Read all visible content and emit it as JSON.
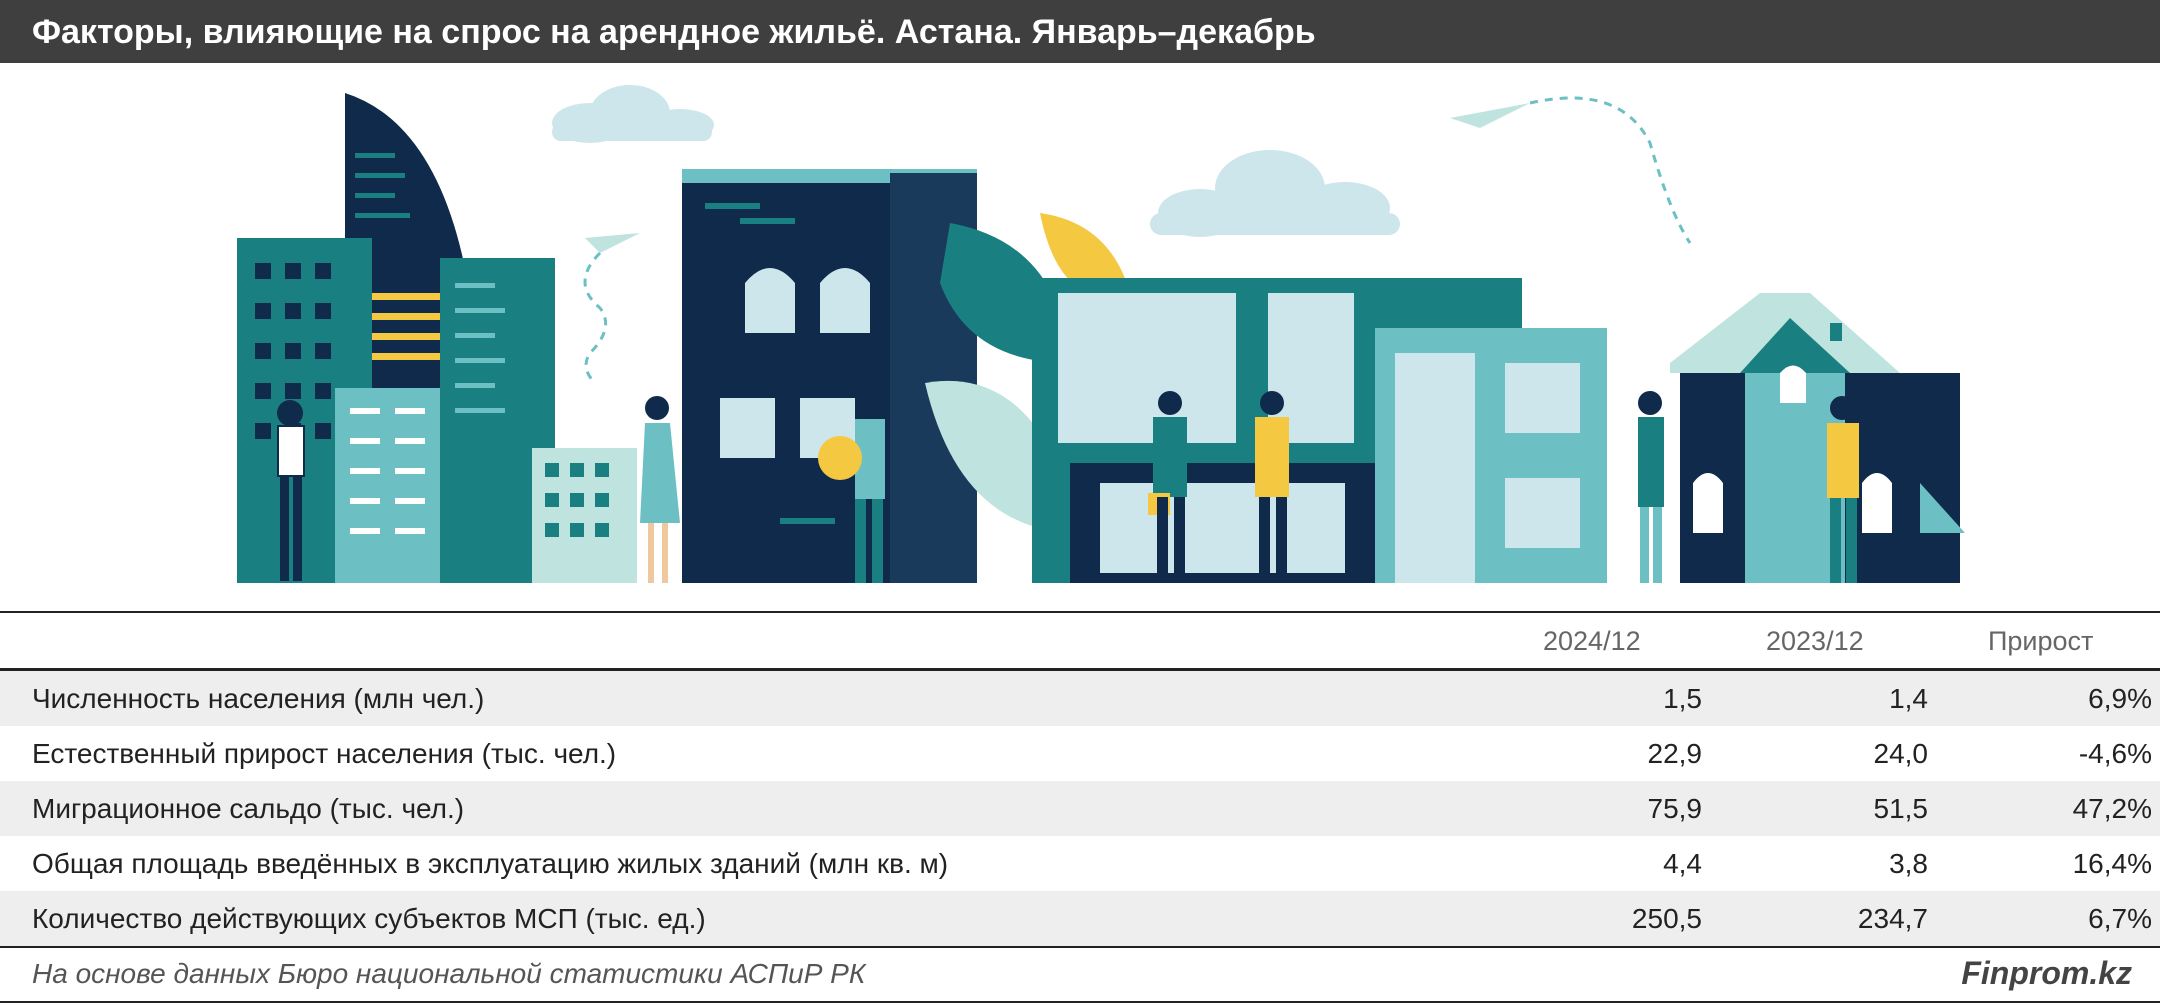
{
  "header": {
    "title": "Факторы, влияющие на спрос на арендное жильё. Астана. Январь–декабрь"
  },
  "colors": {
    "title_bar": "#3f3f3f",
    "dark_navy": "#0f2a4a",
    "teal": "#1a7f80",
    "light_teal": "#6cc0c4",
    "pale_mint": "#bfe3df",
    "yellow": "#f5c842",
    "cloud": "#cde6ec",
    "row_shade": "#eeeeee"
  },
  "table": {
    "columns": [
      "2024/12",
      "2023/12",
      "Прирост"
    ],
    "rows": [
      {
        "label": "Численность населения (млн чел.)",
        "v2024": "1,5",
        "v2023": "1,4",
        "growth": "6,9%"
      },
      {
        "label": "Естественный прирост населения (тыс. чел.)",
        "v2024": "22,9",
        "v2023": "24,0",
        "growth": "-4,6%"
      },
      {
        "label": "Миграционное сальдо (тыс. чел.)",
        "v2024": "75,9",
        "v2023": "51,5",
        "growth": "47,2%"
      },
      {
        "label": "Общая площадь введённых в эксплуатацию жилых зданий (млн кв. м)",
        "v2024": "4,4",
        "v2023": "3,8",
        "growth": "16,4%"
      },
      {
        "label": "Количество действующих субъектов МСП (тыс. ед.)",
        "v2024": "250,5",
        "v2023": "234,7",
        "growth": "6,7%"
      }
    ]
  },
  "footer": {
    "source": "На основе данных Бюро национальной статистики АСПиР РК",
    "brand": "Finprom.kz"
  }
}
